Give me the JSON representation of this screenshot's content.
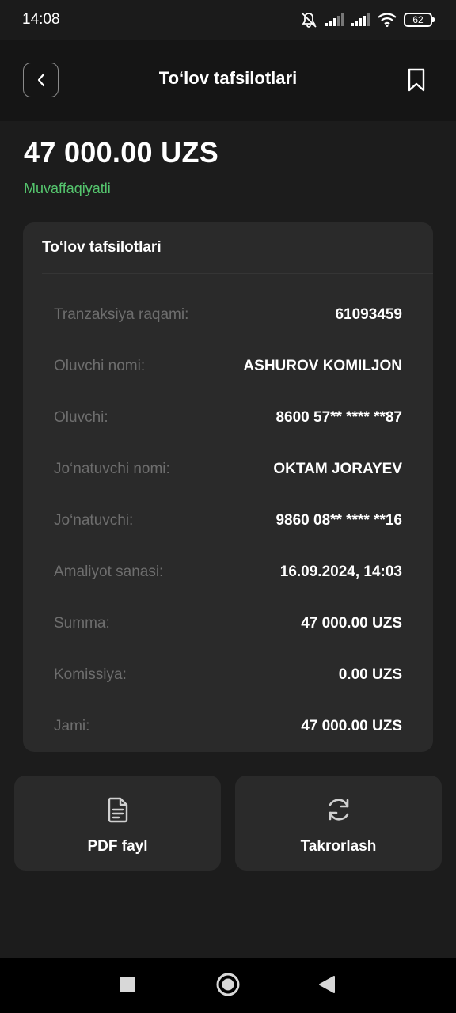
{
  "status_bar": {
    "time": "14:08",
    "battery": "62",
    "icons": [
      "mute-icon",
      "signal-icon",
      "signal-icon",
      "wifi-icon",
      "battery-icon"
    ]
  },
  "header": {
    "title": "To‘lov tafsilotlari",
    "back_icon": "chevron-left-icon",
    "bookmark_icon": "bookmark-icon"
  },
  "summary": {
    "amount": "47 000.00 UZS",
    "status": "Muvaffaqiyatli",
    "status_color": "#55c66e"
  },
  "details": {
    "title": "To‘lov tafsilotlari",
    "rows": [
      {
        "label": "Tranzaksiya raqami:",
        "value": "61093459"
      },
      {
        "label": "Oluvchi nomi:",
        "value": "ASHUROV KOMILJON"
      },
      {
        "label": "Oluvchi:",
        "value": "8600 57** **** **87"
      },
      {
        "label": "Jo‘natuvchi nomi:",
        "value": "OKTAM JORAYEV"
      },
      {
        "label": "Jo‘natuvchi:",
        "value": "9860 08** **** **16"
      },
      {
        "label": "Amaliyot sanasi:",
        "value": "16.09.2024, 14:03"
      },
      {
        "label": "Summa:",
        "value": "47 000.00 UZS"
      },
      {
        "label": "Komissiya:",
        "value": "0.00 UZS"
      },
      {
        "label": "Jami:",
        "value": "47 000.00 UZS"
      }
    ]
  },
  "actions": {
    "pdf_label": "PDF fayl",
    "pdf_icon": "document-icon",
    "repeat_label": "Takrorlash",
    "repeat_icon": "refresh-icon"
  },
  "nav": {
    "icons": [
      "recents-square-icon",
      "home-circle-icon",
      "back-triangle-icon"
    ]
  }
}
